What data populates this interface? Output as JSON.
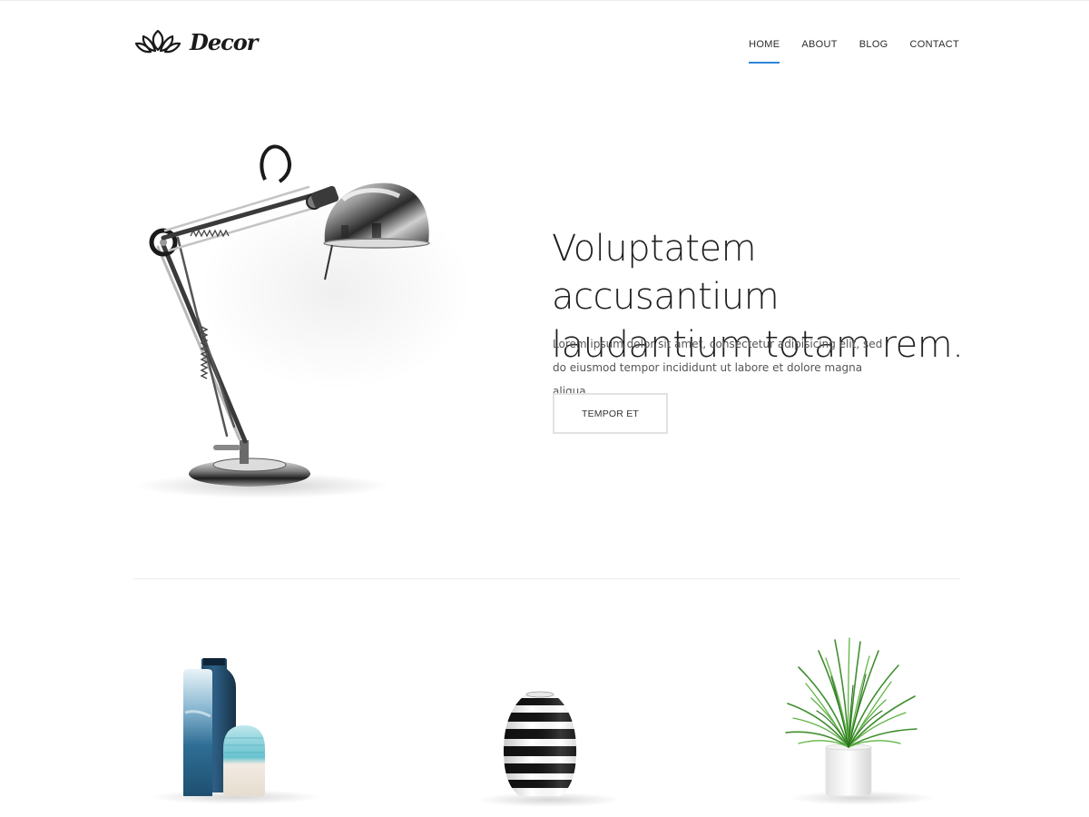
{
  "header": {
    "logo": {
      "text": "Decor",
      "icon": "lotus-icon"
    },
    "nav": {
      "items": [
        {
          "label": "HOME",
          "active": true
        },
        {
          "label": "ABOUT",
          "active": false
        },
        {
          "label": "BLOG",
          "active": false
        },
        {
          "label": "CONTACT",
          "active": false
        }
      ]
    }
  },
  "hero": {
    "image": "desk-lamp-image",
    "title": "Voluptatem accusantium laudantium totam rem.",
    "text": "Lorem ipsum dolor sit amet, consectetur adipisicing elit, sed do eiusmod tempor incididunt ut labore et dolore magna aliqua.",
    "button_label": "TEMPOR ET"
  },
  "products": [
    {
      "image": "blue-vases-image"
    },
    {
      "image": "striped-vase-image"
    },
    {
      "image": "potted-grass-image"
    }
  ],
  "colors": {
    "accent": "#2e86d9",
    "text": "#1f1f1f",
    "muted": "#555555",
    "border": "#e2e2e2",
    "background": "#ffffff"
  }
}
